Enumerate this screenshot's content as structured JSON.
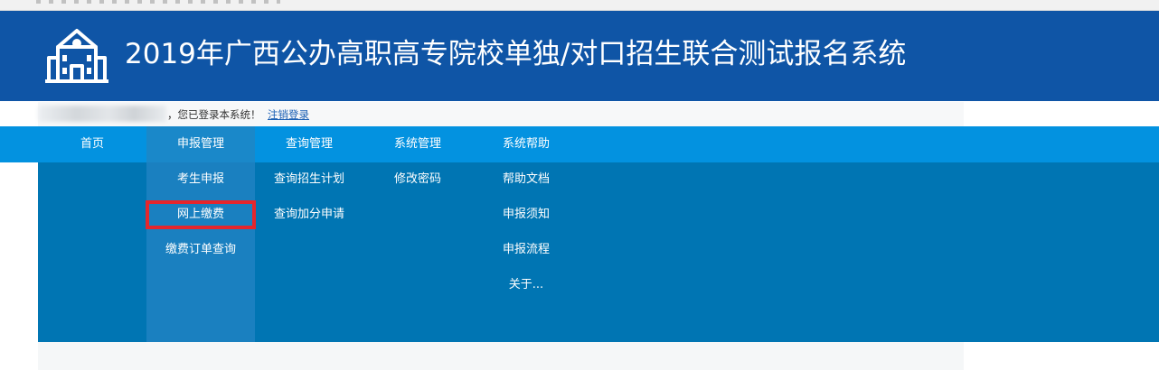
{
  "header": {
    "title": "2019年广西公办高职高专院校单独/对口招生联合测试报名系统",
    "logo_icon": "school-building-icon",
    "background_color": "#0f55a6"
  },
  "userbar": {
    "login_text": "，您已登录本系统！",
    "logout_link": "注销登录"
  },
  "nav": {
    "items": [
      {
        "label": "首页"
      },
      {
        "label": "申报管理"
      },
      {
        "label": "查询管理"
      },
      {
        "label": "系统管理"
      },
      {
        "label": "系统帮助"
      }
    ],
    "active_index": 1,
    "background_color": "#0392e0"
  },
  "dropdown": {
    "columns": [
      {
        "items": [
          "考生申报",
          "网上缴费",
          "缴费订单查询"
        ]
      },
      {
        "items": [
          "查询招生计划",
          "查询加分申请"
        ]
      },
      {
        "items": [
          "修改密码"
        ]
      },
      {
        "items": [
          "帮助文档",
          "申报须知",
          "申报流程",
          "关于..."
        ]
      }
    ],
    "highlighted_item": "网上缴费",
    "highlight_color": "#e5262c",
    "background_color": "#0075b3"
  }
}
